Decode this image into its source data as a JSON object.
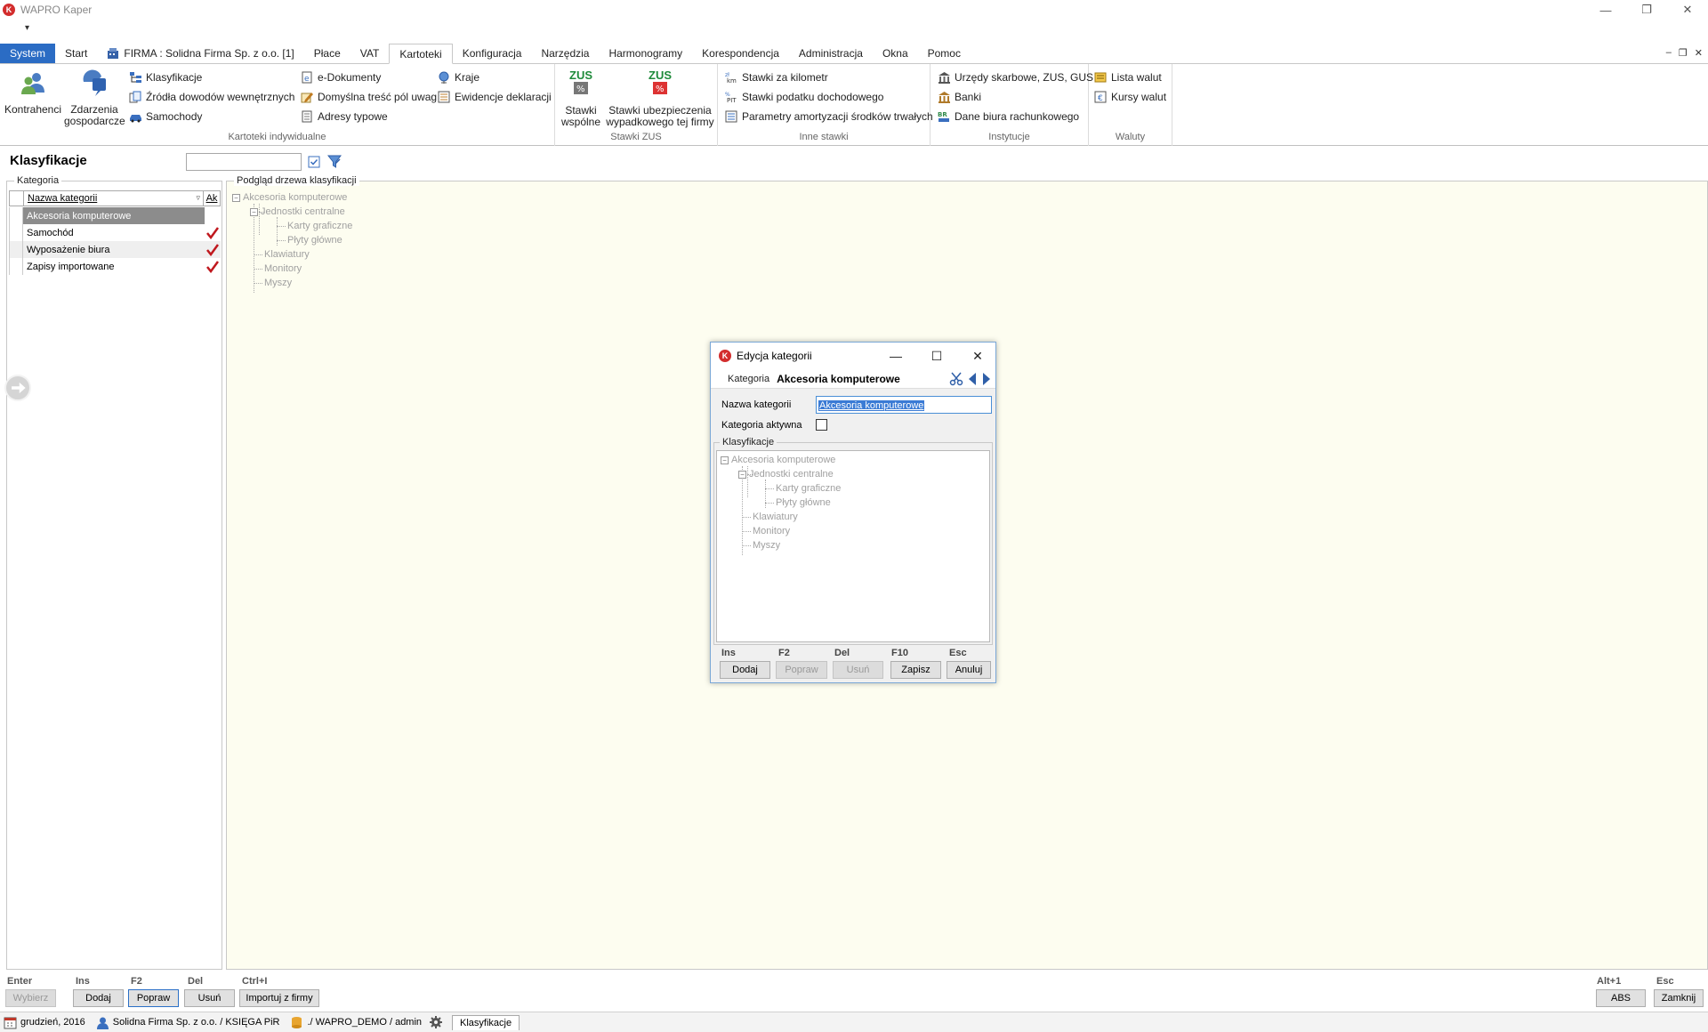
{
  "window": {
    "title": "WAPRO Kaper",
    "logo_letter": "K",
    "qat_symbol": "▾"
  },
  "tabs": [
    {
      "label": "System"
    },
    {
      "label": "Start"
    },
    {
      "label": "FIRMA : Solidna Firma Sp. z o.o. [1]"
    },
    {
      "label": "Płace"
    },
    {
      "label": "VAT"
    },
    {
      "label": "Kartoteki"
    },
    {
      "label": "Konfiguracja"
    },
    {
      "label": "Narzędzia"
    },
    {
      "label": "Harmonogramy"
    },
    {
      "label": "Korespondencja"
    },
    {
      "label": "Administracja"
    },
    {
      "label": "Okna"
    },
    {
      "label": "Pomoc"
    }
  ],
  "ribbon": {
    "kartoteki": {
      "label": "Kartoteki indywidualne",
      "kontrahenci": "Kontrahenci",
      "zdarzenia_line1": "Zdarzenia",
      "zdarzenia_line2": "gospodarcze",
      "klasyfikacje": "Klasyfikacje",
      "zrodla": "Źródła dowodów wewnętrznych",
      "samochody": "Samochody",
      "edokumenty": "e-Dokumenty",
      "domyslna": "Domyślna treść pól uwag",
      "adresy": "Adresy typowe",
      "kraje": "Kraje",
      "ewidencje": "Ewidencje deklaracji"
    },
    "zus": {
      "label": "Stawki ZUS",
      "zus_text": "ZUS",
      "wspolne_line1": "Stawki",
      "wspolne_line2": "wspólne",
      "wypadkowe_line1": "Stawki ubezpieczenia",
      "wypadkowe_line2": "wypadkowego tej firmy"
    },
    "inne": {
      "label": "Inne stawki",
      "kilometr": "Stawki za kilometr",
      "podatek": "Stawki podatku dochodowego",
      "amortyzacja": "Parametry amortyzacji środków trwałych"
    },
    "instytucje": {
      "label": "Instytucje",
      "urzedy": "Urzędy skarbowe, ZUS, GUS",
      "banki": "Banki",
      "dane_biura": "Dane biura rachunkowego"
    },
    "waluty": {
      "label": "Waluty",
      "lista": "Lista walut",
      "kursy": "Kursy walut"
    }
  },
  "page": {
    "title": "Klasyfikacje",
    "search_value": ""
  },
  "left": {
    "caption": "Kategoria",
    "col_name": "Nazwa kategorii",
    "col_akt": "Ak",
    "rows": [
      {
        "name": "Akcesoria komputerowe",
        "active": false
      },
      {
        "name": "Samochód",
        "active": true
      },
      {
        "name": "Wyposażenie biura",
        "active": true
      },
      {
        "name": "Zapisy importowane",
        "active": true
      }
    ]
  },
  "right": {
    "caption": "Podgląd drzewa klasyfikacji"
  },
  "tree": {
    "root": "Akcesoria komputerowe",
    "n1": "Jednostki centralne",
    "n1a": "Karty graficzne",
    "n1b": "Płyty główne",
    "n2": "Klawiatury",
    "n3": "Monitory",
    "n4": "Myszy",
    "expand_symbol": "−"
  },
  "dialog": {
    "title": "Edycja kategorii",
    "sub_label": "Kategoria",
    "sub_value": "Akcesoria komputerowe",
    "name_label": "Nazwa kategorii",
    "name_value": "Akcesoria komputerowe",
    "active_label": "Kategoria aktywna",
    "active_checked": false,
    "group_caption": "Klasyfikacje",
    "keys": [
      "Ins",
      "F2",
      "Del",
      "F10",
      "Esc"
    ],
    "buttons": {
      "dodaj": "Dodaj",
      "popraw": "Popraw",
      "usun": "Usuń",
      "zapisz": "Zapisz",
      "anuluj": "Anuluj"
    }
  },
  "bottom": {
    "keys": {
      "enter": "Enter",
      "ins": "Ins",
      "f2": "F2",
      "del": "Del",
      "ctrli": "Ctrl+I",
      "alt1": "Alt+1",
      "esc": "Esc"
    },
    "buttons": {
      "wybierz": "Wybierz",
      "dodaj": "Dodaj",
      "popraw": "Popraw",
      "usun": "Usuń",
      "importuj": "Importuj z firmy",
      "abs": "ABS",
      "zamknij": "Zamknij"
    }
  },
  "status": {
    "date": "grudzień, 2016",
    "firm": "Solidna Firma Sp. z o.o. / KSIĘGA PiR",
    "db": "./ WAPRO_DEMO / admin",
    "tab": "Klasyfikacje"
  },
  "colors": {
    "system_tab": "#2b6cc4",
    "selected_row": "#8c8c8c",
    "tree_bg": "#fdfdf0",
    "check_red": "#c0181e",
    "zus_green": "#1e8a3a"
  }
}
